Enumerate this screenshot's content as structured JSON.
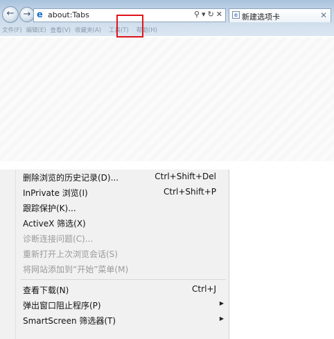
{
  "address_bar": {
    "url": "about:Tabs"
  },
  "tab": {
    "label": "新建选项卡"
  },
  "menubar": {
    "items": [
      "文件(F)",
      "编辑(E)",
      "查看(V)",
      "收藏夹(A)",
      "工具(T)",
      "帮助(H)"
    ]
  },
  "tools_menu": {
    "items": [
      {
        "label": "删除浏览的历史记录(D)...",
        "shortcut": "Ctrl+Shift+Del"
      },
      {
        "label": "InPrivate 浏览(I)",
        "shortcut": "Ctrl+Shift+P"
      },
      {
        "label": "跟踪保护(K)...",
        "shortcut": ""
      },
      {
        "label": "ActiveX 筛选(X)",
        "shortcut": ""
      },
      {
        "label": "诊断连接问题(C)...",
        "shortcut": ""
      },
      {
        "label": "重新打开上次浏览会话(S)",
        "shortcut": ""
      },
      {
        "label": "将网站添加到“开始”菜单(M)",
        "shortcut": ""
      },
      {
        "label": "查看下载(N)",
        "shortcut": "Ctrl+J"
      },
      {
        "label": "弹出窗口阻止程序(P)",
        "shortcut": ""
      },
      {
        "label": "SmartScreen 筛选器(T)",
        "shortcut": ""
      }
    ]
  },
  "colors": {
    "highlight_box": "#e0141c",
    "menu_background": "#f1f1f1",
    "disabled_text": "#9a9a9a"
  }
}
